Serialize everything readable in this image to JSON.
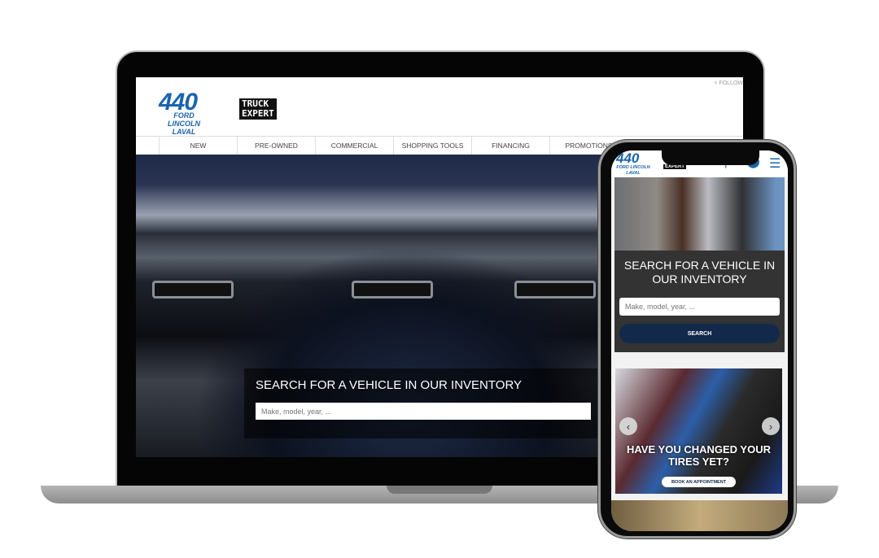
{
  "desktop": {
    "logo": {
      "number": "440",
      "line1": "FORD LINCOLN",
      "line2": "LAVAL",
      "badge_line1": "TRUCK",
      "badge_line2": "EXPERT"
    },
    "follow": "FOLLOW",
    "nav": [
      "NEW",
      "PRE-OWNED",
      "COMMERCIAL",
      "SHOPPING TOOLS",
      "FINANCING",
      "PROMOTIONS"
    ],
    "search": {
      "title": "SEARCH FOR A VEHICLE IN OUR INVENTORY",
      "placeholder": "Make, model, year, ..."
    }
  },
  "mobile": {
    "logo": {
      "number": "440",
      "line1": "FORD LINCOLN",
      "line2": "LAVAL",
      "badge": "EXPERT"
    },
    "search": {
      "title": "SEARCH FOR A VEHICLE IN OUR INVENTORY",
      "placeholder": "Make, model, year, ...",
      "button": "SEARCH"
    },
    "promo": {
      "title": "HAVE YOU CHANGED YOUR TIRES YET?",
      "button": "BOOK AN APPOINTMENT",
      "prev": "‹",
      "next": "›"
    },
    "icons": [
      "search-icon",
      "location-pin-icon",
      "menu-icon"
    ]
  },
  "colors": {
    "brand_blue": "#1a64ad",
    "navy": "#13294b"
  }
}
